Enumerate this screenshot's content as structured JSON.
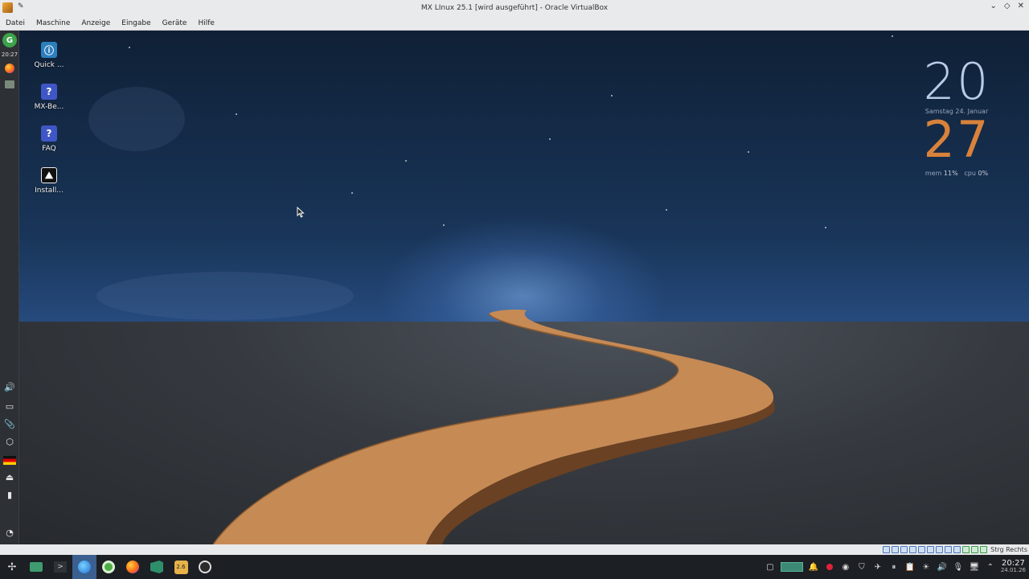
{
  "window": {
    "title": "MX LInux 25.1 [wird ausgeführt] - Oracle VirtualBox",
    "controls": {
      "minimize": "⌄",
      "maximize": "◇",
      "close": "✕"
    }
  },
  "menubar": {
    "items": [
      "Datei",
      "Maschine",
      "Anzeige",
      "Eingabe",
      "Geräte",
      "Hilfe"
    ]
  },
  "left_panel": {
    "clock": "20:27"
  },
  "desktop_icons": [
    {
      "label": "Quick ...",
      "icon": "quick-icon"
    },
    {
      "label": "MX-Be...",
      "icon": "help-icon"
    },
    {
      "label": "FAQ",
      "icon": "help-icon"
    },
    {
      "label": "Install...",
      "icon": "installer-icon"
    }
  ],
  "conky": {
    "hour": "20",
    "date": "Samstag  24. Januar",
    "minute": "27",
    "mem_label": "mem",
    "mem_value": "11%",
    "cpu_label": "cpu",
    "cpu_value": "0%"
  },
  "statusbar": {
    "host_key": "Strg Rechts"
  },
  "taskbar": {
    "time": "20:27",
    "date": "24.01.26",
    "badge": "2.6"
  },
  "colors": {
    "conky_hour": "#b9cbe6",
    "conky_minute": "#d9823b",
    "panel": "#2d3035",
    "taskbar": "#1c1f23"
  }
}
